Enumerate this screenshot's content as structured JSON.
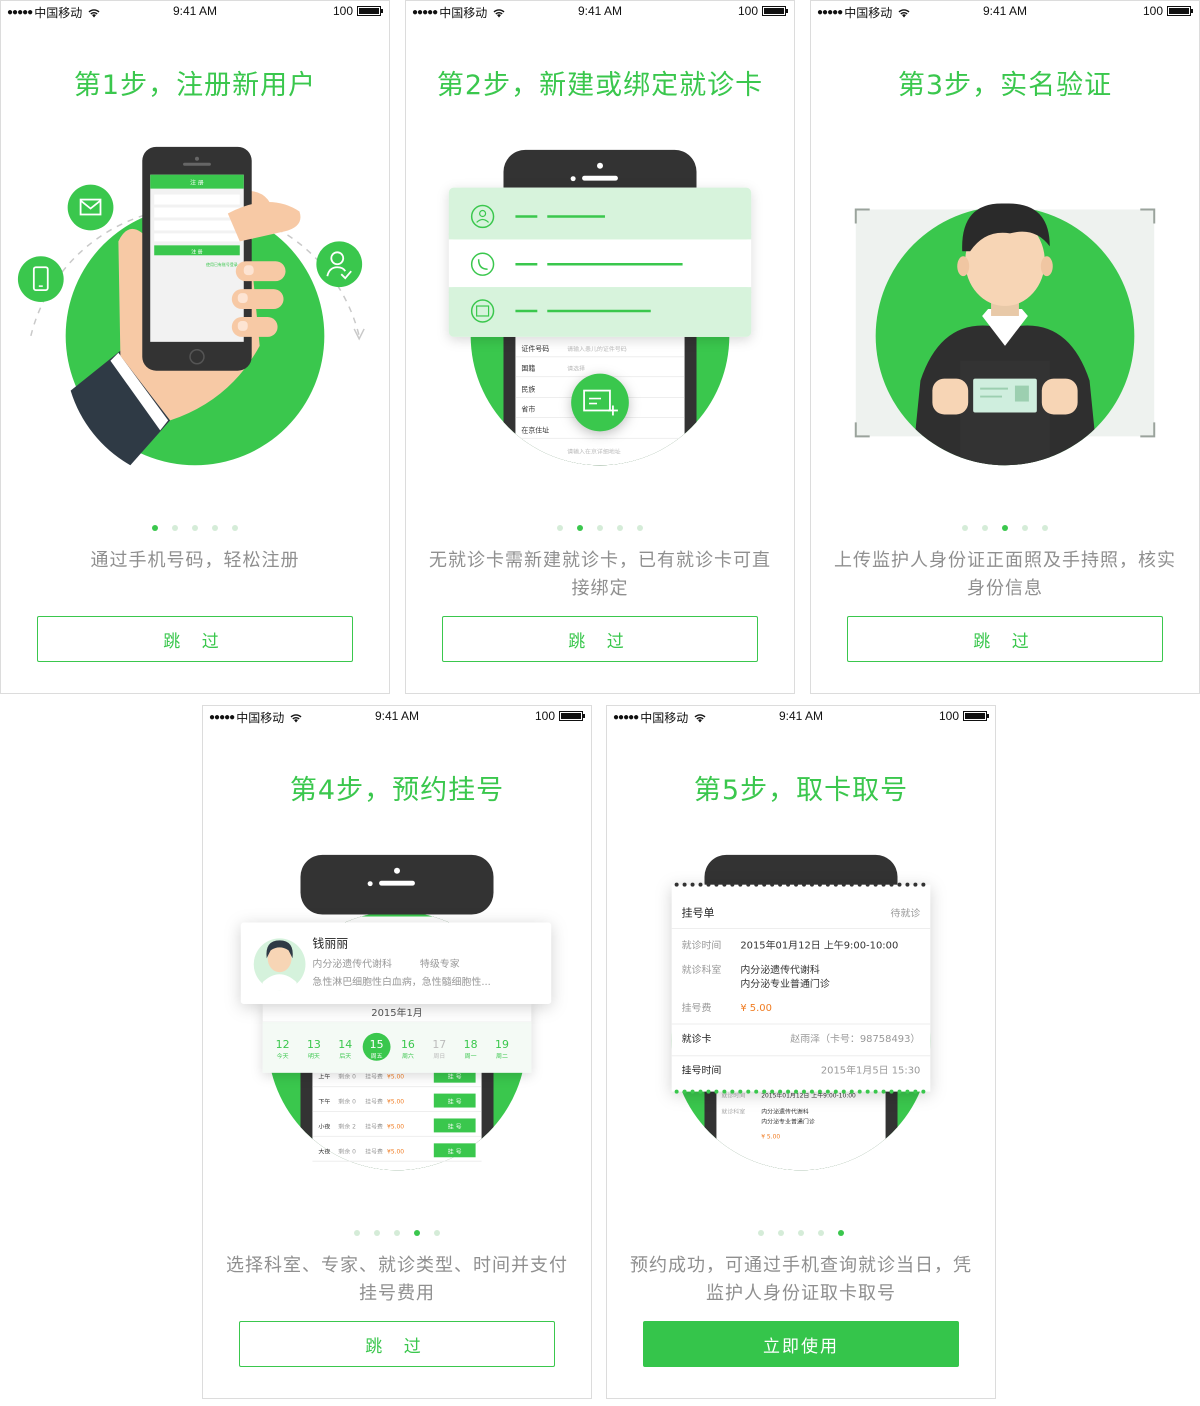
{
  "status_bar": {
    "carrier": "中国移动",
    "time": "9:41 AM",
    "battery": "100"
  },
  "screens": [
    {
      "title": "第1步，注册新用户",
      "description": "通过手机号码，轻松注册",
      "button": "跳 过",
      "page_index": 1,
      "phone": {
        "header": "注 册",
        "button": "注 册",
        "link": "使用已有账号登录"
      }
    },
    {
      "title": "第2步，新建或绑定就诊卡",
      "description": "无就诊卡需新建就诊卡，已有就诊卡可直接绑定",
      "button": "跳 过",
      "page_index": 2,
      "form_rows": [
        {
          "label": "证件号码",
          "placeholder": "请输入患儿的证件号码"
        },
        {
          "label": "国籍",
          "placeholder": "请选择"
        },
        {
          "label": "民族",
          "placeholder": ""
        },
        {
          "label": "省市",
          "placeholder": ""
        },
        {
          "label": "在京住址",
          "placeholder": ""
        },
        {
          "label": "地址",
          "placeholder": "请输入在京详细地址"
        }
      ]
    },
    {
      "title": "第3步，实名验证",
      "description": "上传监护人身份证正面照及手持照，核实身份信息",
      "button": "跳 过",
      "page_index": 3
    },
    {
      "title": "第4步，预约挂号",
      "description": "选择科室、专家、就诊类型、时间并支付挂号费用",
      "button": "跳 过",
      "page_index": 4,
      "doctor": {
        "name": "钱丽丽",
        "department": "内分泌遗传代谢科",
        "level": "特级专家",
        "specialty": "急性淋巴细胞性白血病，急性髓细胞性..."
      },
      "month": "2015年1月",
      "dates": [
        {
          "day": "12",
          "week": "今天"
        },
        {
          "day": "13",
          "week": "明天"
        },
        {
          "day": "14",
          "week": "后天"
        },
        {
          "day": "15",
          "week": "周五",
          "selected": true
        },
        {
          "day": "16",
          "week": "周六"
        },
        {
          "day": "17",
          "week": "周日",
          "disabled": true
        },
        {
          "day": "18",
          "week": "周一"
        },
        {
          "day": "19",
          "week": "周二"
        }
      ],
      "slots": [
        {
          "period": "上午",
          "remain": "剩余 0",
          "fee": "挂号费",
          "price": "¥5.00",
          "action": "挂 号"
        },
        {
          "period": "下午",
          "remain": "剩余 0",
          "fee": "挂号费",
          "price": "¥5.00",
          "action": "挂 号"
        },
        {
          "period": "小夜",
          "remain": "剩余 2",
          "fee": "挂号费",
          "price": "¥5.00",
          "action": "挂 号"
        },
        {
          "period": "大夜",
          "remain": "剩余 0",
          "fee": "挂号费",
          "price": "¥5.00",
          "action": "挂 号"
        }
      ]
    },
    {
      "title": "第5步，取卡取号",
      "description": "预约成功，可通过手机查询就诊当日，凭监护人身份证取卡取号",
      "button": "立即使用",
      "page_index": 5,
      "ticket": {
        "header": "挂号单",
        "status": "待就诊",
        "visit_time_label": "就诊时间",
        "visit_time": "2015年01月12日  上午9:00-10:00",
        "dept_label": "就诊科室",
        "dept_line1": "内分泌遗传代谢科",
        "dept_line2": "内分泌专业普通门诊",
        "fee_label": "挂号费",
        "fee": "¥ 5.00",
        "card_label": "就诊卡",
        "card_value": "赵雨泽（卡号：98758493）",
        "reg_time_label": "挂号时间",
        "reg_time": "2015年1月5日    15:30"
      }
    }
  ],
  "colors": {
    "accent": "#3ac74d",
    "dark": "#333333",
    "muted": "#8f8f8f",
    "price": "#f07c22"
  }
}
